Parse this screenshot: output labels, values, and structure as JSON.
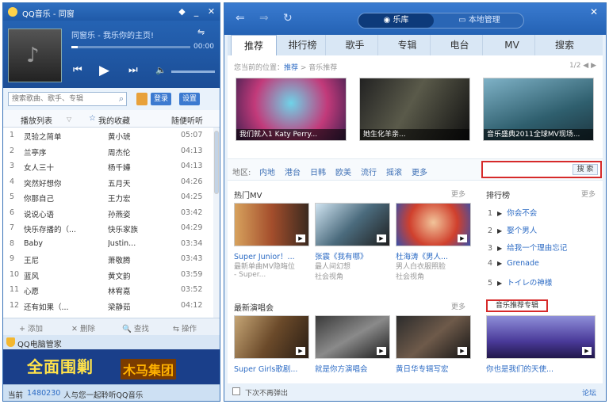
{
  "player": {
    "title": "QQ音乐 - 同窗",
    "now_playing": "同窗乐 - 我乐你的主页!",
    "time": "00:00",
    "progress": 0.05,
    "controls": [
      "prev-icon",
      "play-icon",
      "next-icon",
      "volume-icon"
    ]
  },
  "search": {
    "placeholder": "搜索歌曲、歌手、专辑",
    "btn1": "登录",
    "btn2": "设置"
  },
  "list_tabs": {
    "t1": "播放列表",
    "t2": "我的收藏",
    "t3": "随便听听"
  },
  "songs": [
    {
      "n": "1",
      "title": "灵验之简单",
      "artist": "黄小琥",
      "dur": "05:07"
    },
    {
      "n": "2",
      "title": "兰亭序",
      "artist": "周杰伦",
      "dur": "04:13"
    },
    {
      "n": "3",
      "title": "女人三十",
      "artist": "杨千嬅",
      "dur": "04:13"
    },
    {
      "n": "4",
      "title": "突然好想你",
      "artist": "五月天",
      "dur": "04:26"
    },
    {
      "n": "5",
      "title": "你那自己",
      "artist": "王力宏",
      "dur": "04:25"
    },
    {
      "n": "6",
      "title": "说说心语",
      "artist": "孙燕姿",
      "dur": "03:42"
    },
    {
      "n": "7",
      "title": "快乐存播的（...",
      "artist": "快乐家族",
      "dur": "04:29"
    },
    {
      "n": "8",
      "title": "Baby",
      "artist": "Justin...",
      "dur": "03:34"
    },
    {
      "n": "9",
      "title": "王尼",
      "artist": "萧敬腾",
      "dur": "03:43"
    },
    {
      "n": "10",
      "title": "蓝风",
      "artist": "黄文韵",
      "dur": "03:59"
    },
    {
      "n": "11",
      "title": "心愿",
      "artist": "林宥嘉",
      "dur": "03:52"
    },
    {
      "n": "12",
      "title": "还有如果（...",
      "artist": "梁静茹",
      "dur": "04:12"
    }
  ],
  "bottom_actions": {
    "add": "+ 添加",
    "del": "✕ 删除",
    "find": "🔍 查找",
    "more": "⇆ 操作"
  },
  "ad": {
    "header": "QQ电脑管家",
    "main": "全面围剿",
    "sub": "木马集团"
  },
  "status": {
    "label": "当前",
    "count": "1480230",
    "text": "人与您一起聆听QQ音乐"
  },
  "top": {
    "seg_on": "乐库",
    "seg_off": "本地管理"
  },
  "tabs": [
    "推荐",
    "排行榜",
    "歌手",
    "专辑",
    "电台",
    "MV",
    "搜索"
  ],
  "breadcrumb": {
    "pre": "您当前的位置：",
    "cur": "推荐",
    "sep": " > ",
    "page": "音乐推荐"
  },
  "pager": "1/2 ◀ ▶",
  "banners": [
    "我们就入1 Katy Perry...",
    "她生化羊亲...",
    "音乐盛典2011全球MV现场..."
  ],
  "filters": [
    "地区:",
    "内地",
    "港台",
    "日韩",
    "欧美",
    "流行",
    "摇滚",
    "更多"
  ],
  "filter_search_btn": "搜 索",
  "hot_mv": {
    "title": "热门MV",
    "more": "更多"
  },
  "mvs": [
    {
      "title": "Super Junior！...",
      "sub1": "最新单曲MV隐晦位",
      "sub2": "- Super..."
    },
    {
      "title": "张震《我有哪》",
      "sub1": "最人间幻想",
      "sub2": "社会视角"
    },
    {
      "title": "杜海涛《男人...",
      "sub1": "男人白衣服照脸",
      "sub2": "社会视角"
    }
  ],
  "rank": {
    "title": "排行榜",
    "more": "更多",
    "items": [
      "你会不会",
      "娶个男人",
      "给我一个理由忘记",
      "Grenade",
      "トイレの神様"
    ]
  },
  "rec": {
    "title": "最新演唱会",
    "more": "更多",
    "label": "音乐推荐专辑"
  },
  "concerts": [
    "Super Girls歌剧...",
    "就是你方演唱会",
    "黄日华专辑写宏",
    "你也是我们的天使..."
  ],
  "footer": {
    "checkbox": "下次不再弹出",
    "right": "论坛"
  }
}
